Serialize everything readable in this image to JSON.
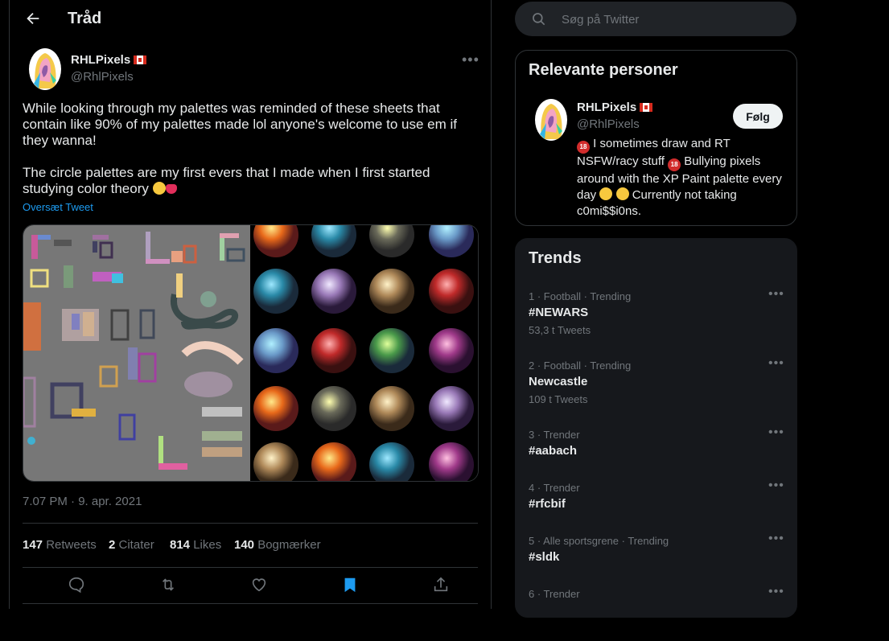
{
  "header": {
    "title": "Tråd"
  },
  "tweet": {
    "author_name": "RHLPixels",
    "author_handle": "@RhlPixels",
    "paragraph1": "While looking through my palettes was reminded of these sheets that contain like 90% of my palettes made lol anyone's welcome to use em if they wanna!",
    "paragraph2": "The circle palettes are my first evers that I made when I first started studying color theory",
    "translate": "Oversæt Tweet",
    "timestamp": "7.07 PM · 9. apr. 2021",
    "stats": {
      "retweets_count": "147",
      "retweets_label": "Retweets",
      "quotes_count": "2",
      "quotes_label": "Citater",
      "likes_count": "814",
      "likes_label": "Likes",
      "bookmarks_count": "140",
      "bookmarks_label": "Bogmærker"
    }
  },
  "search": {
    "placeholder": "Søg på Twitter"
  },
  "relevant": {
    "title": "Relevante personer",
    "name": "RHLPixels",
    "handle": "@RhlPixels",
    "follow": "Følg",
    "bio_part1": " I sometimes draw and RT NSFW/racy stuff ",
    "bio_part2": " Bullying pixels around with the XP Paint palette every day ",
    "bio_part3": " Currently not taking c0mi$$i0ns.",
    "badge": "18"
  },
  "trends": {
    "title": "Trends",
    "items": [
      {
        "meta": "1 · Football · Trending",
        "name": "#NEWARS",
        "count": "53,3 t Tweets"
      },
      {
        "meta": "2 · Football · Trending",
        "name": "Newcastle",
        "count": "109 t Tweets"
      },
      {
        "meta": "3 · Trender",
        "name": "#aabach",
        "count": ""
      },
      {
        "meta": "4 · Trender",
        "name": "#rfcbif",
        "count": ""
      },
      {
        "meta": "5 · Alle sportsgrene · Trending",
        "name": "#sldk",
        "count": ""
      },
      {
        "meta": "6 · Trender",
        "name": "",
        "count": ""
      }
    ]
  },
  "colors": {
    "accent": "#1d9bf0",
    "bookmark_active": "#1d9bf0",
    "background": "#000000",
    "panel": "#16181c"
  }
}
